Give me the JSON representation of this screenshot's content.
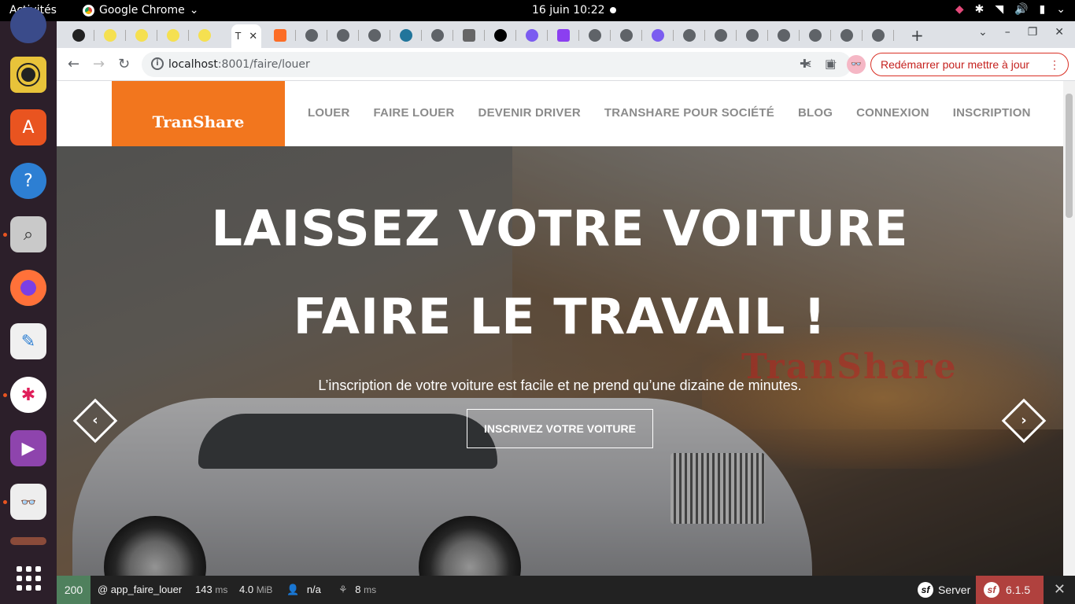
{
  "topbar": {
    "activities": "Activités",
    "app_name": "Google Chrome",
    "clock": "16 juin  10:22"
  },
  "browser": {
    "url_host": "localhost",
    "url_path": ":8001/faire/louer",
    "update_button": "Redémarrer pour mettre à jour",
    "active_tab_label": "T"
  },
  "site": {
    "logo": "TranShare",
    "menu": [
      "LOUER",
      "FAIRE LOUER",
      "DEVENIR DRIVER",
      "TRANSHARE POUR SOCIÉTÉ",
      "BLOG",
      "CONNEXION",
      "INSCRIPTION"
    ],
    "hero_title_line1": "LAISSEZ VOTRE VOITURE",
    "hero_title_line2": "FAIRE LE TRAVAIL !",
    "hero_subtitle": "L’inscription de votre voiture est facile et ne prend qu’une dizaine de minutes.",
    "cta": "INSCRIVEZ VOTRE VOITURE",
    "watermark": "TranShare"
  },
  "debug_toolbar": {
    "status": "200",
    "route": "@ app_faire_louer",
    "time_value": "143",
    "time_unit": "ms",
    "memory_value": "4.0",
    "memory_unit": "MiB",
    "user": "n/a",
    "twig_value": "8",
    "twig_unit": "ms",
    "server": "Server",
    "version": "6.1.5"
  },
  "colors": {
    "brand_orange": "#f2761e",
    "update_red": "#c5221f",
    "sf_green": "#4f805d",
    "sf_red": "#b0413e"
  }
}
